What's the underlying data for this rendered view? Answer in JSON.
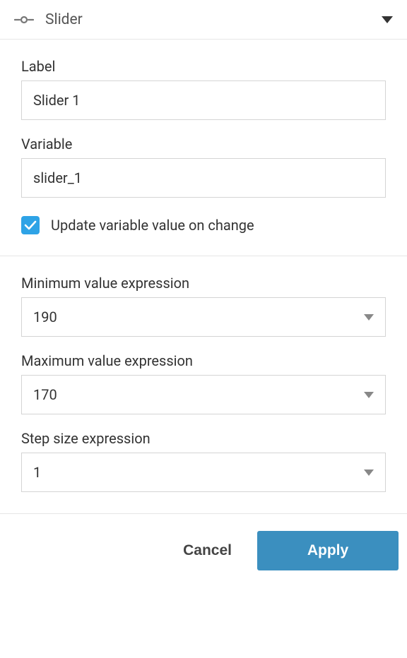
{
  "header": {
    "title": "Slider"
  },
  "fields": {
    "label": {
      "label": "Label",
      "value": "Slider 1"
    },
    "variable": {
      "label": "Variable",
      "value": "slider_1"
    },
    "update_on_change": {
      "label": "Update variable value on change",
      "checked": true
    },
    "min_expr": {
      "label": "Minimum value expression",
      "value": "190"
    },
    "max_expr": {
      "label": "Maximum value expression",
      "value": "170"
    },
    "step_expr": {
      "label": "Step size expression",
      "value": "1"
    }
  },
  "footer": {
    "cancel": "Cancel",
    "apply": "Apply"
  }
}
